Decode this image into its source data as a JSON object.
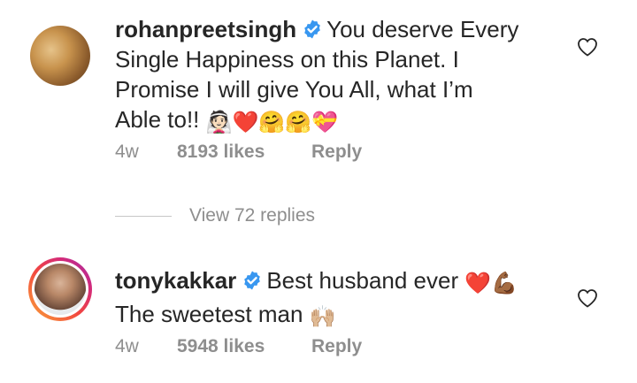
{
  "comments": [
    {
      "username": "rohanpreetsingh",
      "text_line1": "You deserve Every",
      "text_line2": "Single Happiness on this Planet. I",
      "text_line3": "Promise I will give You All, what I’m",
      "text_line4": "Able to!!",
      "emojis": "👰🏻❤️🤗🤗💝",
      "time": "4w",
      "likes": "8193 likes",
      "reply_label": "Reply"
    },
    {
      "username": "tonykakkar",
      "text_line1": "Best husband ever",
      "emojis_line1": "❤️💪🏾",
      "text_line2": "The sweetest man",
      "emojis_line2": "🙌🏼",
      "time": "4w",
      "likes": "5948 likes",
      "reply_label": "Reply"
    }
  ],
  "view_replies_label": "View 72 replies",
  "colors": {
    "text": "#262626",
    "muted": "#8e8e8e",
    "verified": "#3897f0"
  }
}
